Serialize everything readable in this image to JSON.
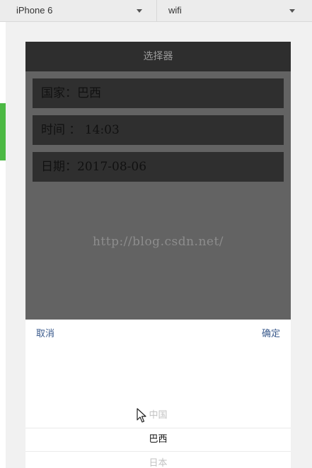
{
  "toolbar": {
    "device": "iPhone 6",
    "network": "wifi"
  },
  "app": {
    "title": "选择器",
    "fields": {
      "country": "国家：巴西",
      "time": "时间 ： 14:03",
      "date": "日期：2017-08-06"
    },
    "watermark": "http://blog.csdn.net/"
  },
  "picker": {
    "cancel_label": "取消",
    "confirm_label": "确定",
    "options_visible": [
      "中国",
      "巴西",
      "日本"
    ],
    "selected": "巴西"
  },
  "colors": {
    "accent_green": "#4cb944",
    "button_blue": "#3a5a8c",
    "nav_dark": "#2e2e2e"
  },
  "icons": {
    "dropdown": "chevron-down-icon",
    "pointer": "mouse-cursor-icon"
  }
}
